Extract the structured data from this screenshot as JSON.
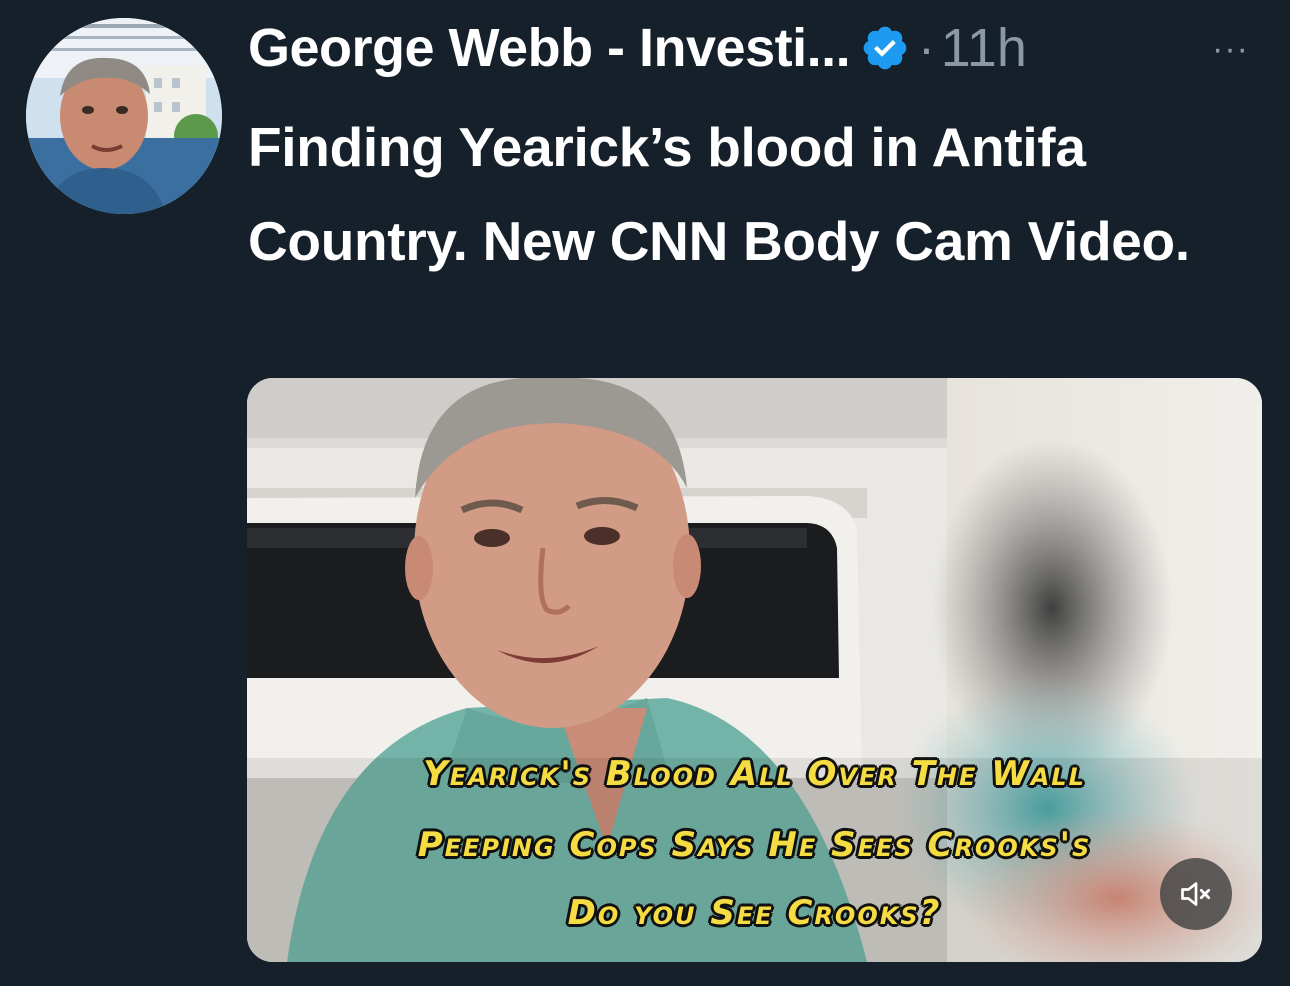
{
  "author": {
    "display_name": "George Webb - Investi...",
    "timestamp": "11h",
    "separator": "·",
    "more_label": "···",
    "avatar_icon": "avatar"
  },
  "tweet": {
    "text": "Finding Yearick’s blood in Antifa Country. New CNN Body Cam Video."
  },
  "media": {
    "caption_lines": [
      "Yearick's Blood All Over The Wall",
      "Peeping Cops Says He Sees Crooks's",
      "Do you See Crooks?"
    ],
    "mute_icon": "speaker-muted-icon"
  },
  "colors": {
    "background": "#15202b",
    "secondary_text": "#8b98a5",
    "verified_badge": "#1d9bf0",
    "caption_text": "#f4dc42"
  }
}
